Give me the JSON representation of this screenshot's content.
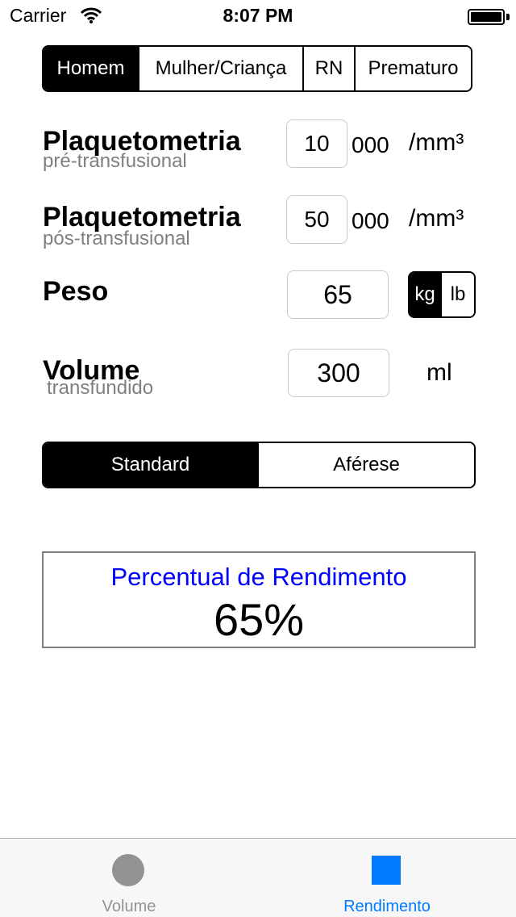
{
  "status_bar": {
    "carrier": "Carrier",
    "time": "8:07 PM"
  },
  "patient_type": {
    "options": [
      "Homem",
      "Mulher/Criança",
      "RN",
      "Prematuro"
    ],
    "selected": "Homem"
  },
  "pre": {
    "label": "Plaquetometria",
    "sublabel": "pré-transfusional",
    "value": "10",
    "suffix": "000",
    "unit": "/mm³"
  },
  "post": {
    "label": "Plaquetometria",
    "sublabel": "pós-transfusional",
    "value": "50",
    "suffix": "000",
    "unit": "/mm³"
  },
  "weight": {
    "label": "Peso",
    "value": "65",
    "units": [
      "kg",
      "lb"
    ],
    "selected_unit": "kg"
  },
  "volume": {
    "label": "Volume",
    "sublabel": "transfundido",
    "value": "300",
    "unit": "ml"
  },
  "type": {
    "options": [
      "Standard",
      "Aférese"
    ],
    "selected": "Standard"
  },
  "result": {
    "label": "Percentual de Rendimento",
    "value": "65%"
  },
  "tab_bar": {
    "volume_label": "Volume",
    "rendimento_label": "Rendimento",
    "active": "Rendimento",
    "active_color": "#007aff",
    "inactive_color": "#929292"
  }
}
